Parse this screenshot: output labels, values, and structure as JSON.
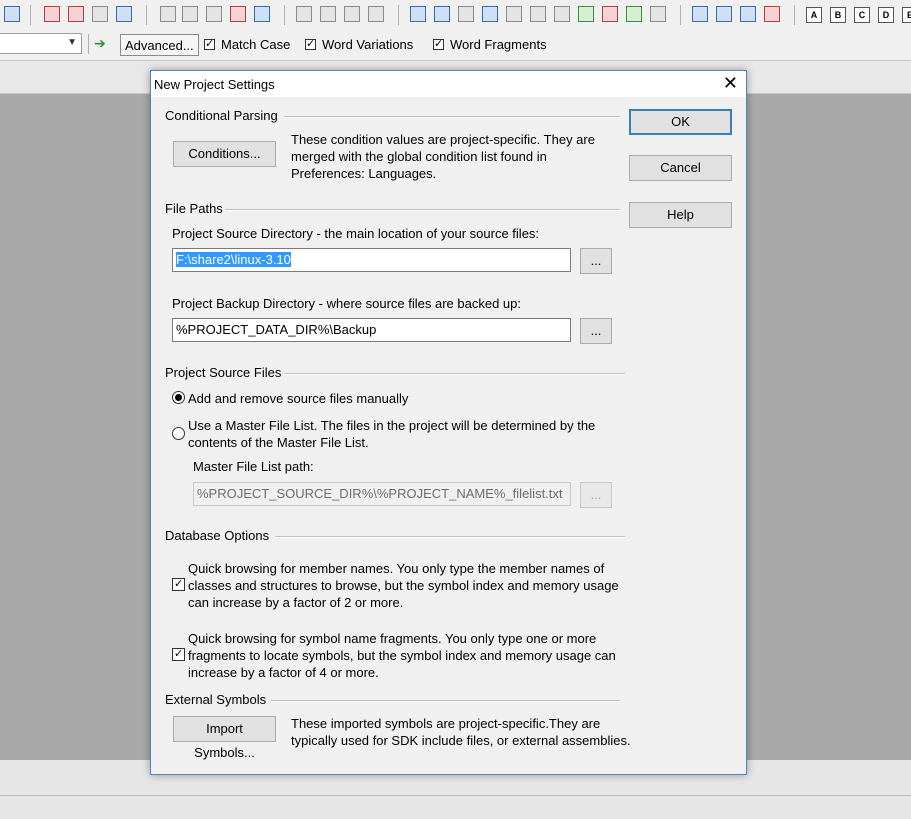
{
  "toolbar2": {
    "advanced_label": "Advanced...",
    "match_case_label": "Match Case",
    "word_variations_label": "Word Variations",
    "word_fragments_label": "Word Fragments",
    "match_case_checked": true,
    "word_variations_checked": true,
    "word_fragments_checked": true
  },
  "toolbar1": {
    "letter_icons": [
      "A",
      "B",
      "C",
      "D",
      "E"
    ]
  },
  "dialog": {
    "title": "New Project Settings",
    "close_glyph": "✕",
    "ok_label": "OK",
    "cancel_label": "Cancel",
    "help_label": "Help",
    "conditional_parsing": {
      "heading": "Conditional Parsing",
      "button_label": "Conditions...",
      "description": "These condition values are project-specific.  They are merged with the global condition list found in Preferences: Languages."
    },
    "file_paths": {
      "heading": "File Paths",
      "source_dir_label": "Project Source Directory - the main location of your source files:",
      "source_dir_value": "F:\\share2\\linux-3.10",
      "backup_dir_label": "Project Backup Directory - where source files are backed up:",
      "backup_dir_value": "%PROJECT_DATA_DIR%\\Backup",
      "browse_label": "..."
    },
    "source_files": {
      "heading": "Project Source Files",
      "option_manual": "Add and remove source files manually",
      "option_master": "Use a Master File List. The files in the project will be determined by the contents of the Master File List.",
      "selected": "manual",
      "master_path_label": "Master File List path:",
      "master_path_value": "%PROJECT_SOURCE_DIR%\\%PROJECT_NAME%_filelist.txt",
      "browse_label": "..."
    },
    "database_options": {
      "heading": "Database Options",
      "member_names_text": "Quick browsing for member names.  You only type the member names of classes and structures to browse, but the symbol index and memory usage can increase by a factor of 2 or more.",
      "member_names_checked": true,
      "fragments_text": "Quick browsing for symbol name fragments.  You only type one or more fragments to locate symbols, but the symbol index and memory usage can increase by a factor of 4 or more.",
      "fragments_checked": true
    },
    "external_symbols": {
      "heading": "External Symbols",
      "button_label": "Import Symbols...",
      "description": "These imported symbols are project-specific.They are typically used for SDK include files, or external assemblies."
    }
  }
}
